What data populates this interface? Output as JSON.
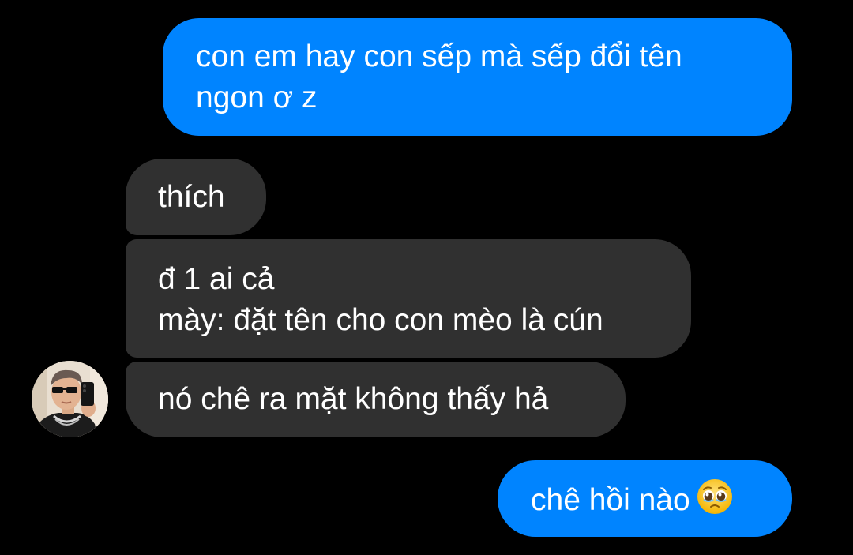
{
  "conversation": {
    "messages": [
      {
        "from": "me",
        "lines": [
          "con em hay con sếp mà sếp đổi tên",
          "ngon ơ z"
        ]
      },
      {
        "from": "contact",
        "lines": [
          "thích"
        ]
      },
      {
        "from": "contact",
        "lines": [
          "đ 1 ai cả",
          "mày: đặt tên cho con mèo là cún"
        ]
      },
      {
        "from": "contact",
        "lines": [
          "nó chê ra mặt không thấy hả"
        ]
      },
      {
        "from": "me",
        "lines": [
          "chê hồi nào"
        ],
        "emoji": "pleading-face"
      }
    ]
  },
  "colors": {
    "background": "#000000",
    "sent_bubble": "#0084ff",
    "received_bubble": "#303030",
    "text": "#ffffff"
  },
  "icons": {
    "emoji": "pleading-face-icon",
    "avatar": "contact-avatar"
  }
}
